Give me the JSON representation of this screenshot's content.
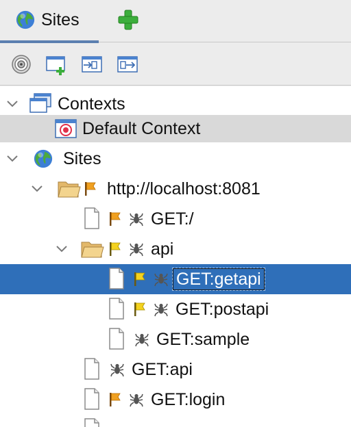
{
  "tab": {
    "label": "Sites",
    "icon": "globe-icon"
  },
  "add_tab": {
    "icon": "plus-icon"
  },
  "toolbar": {
    "buttons": [
      {
        "icon": "target-icon"
      },
      {
        "icon": "new-context-icon"
      },
      {
        "icon": "import-context-icon"
      },
      {
        "icon": "export-context-icon"
      }
    ]
  },
  "tree": {
    "contexts_label": "Contexts",
    "default_context_label": "Default Context",
    "sites_label": "Sites",
    "host_label": "http://localhost:8081",
    "nodes": {
      "get_root": "GET:/",
      "api_folder": "api",
      "get_getapi": "GET:getapi",
      "get_postapi": "GET:postapi",
      "get_sample": "GET:sample",
      "get_api": "GET:api",
      "get_login": "GET:login"
    }
  },
  "colors": {
    "selection": "#2f6fb9",
    "context_highlight": "#d9d9d9",
    "tab_underline": "#5b7fb0",
    "add_green": "#3cae3c",
    "flag_orange": "#f0a020",
    "flag_yellow": "#e8c81a"
  }
}
